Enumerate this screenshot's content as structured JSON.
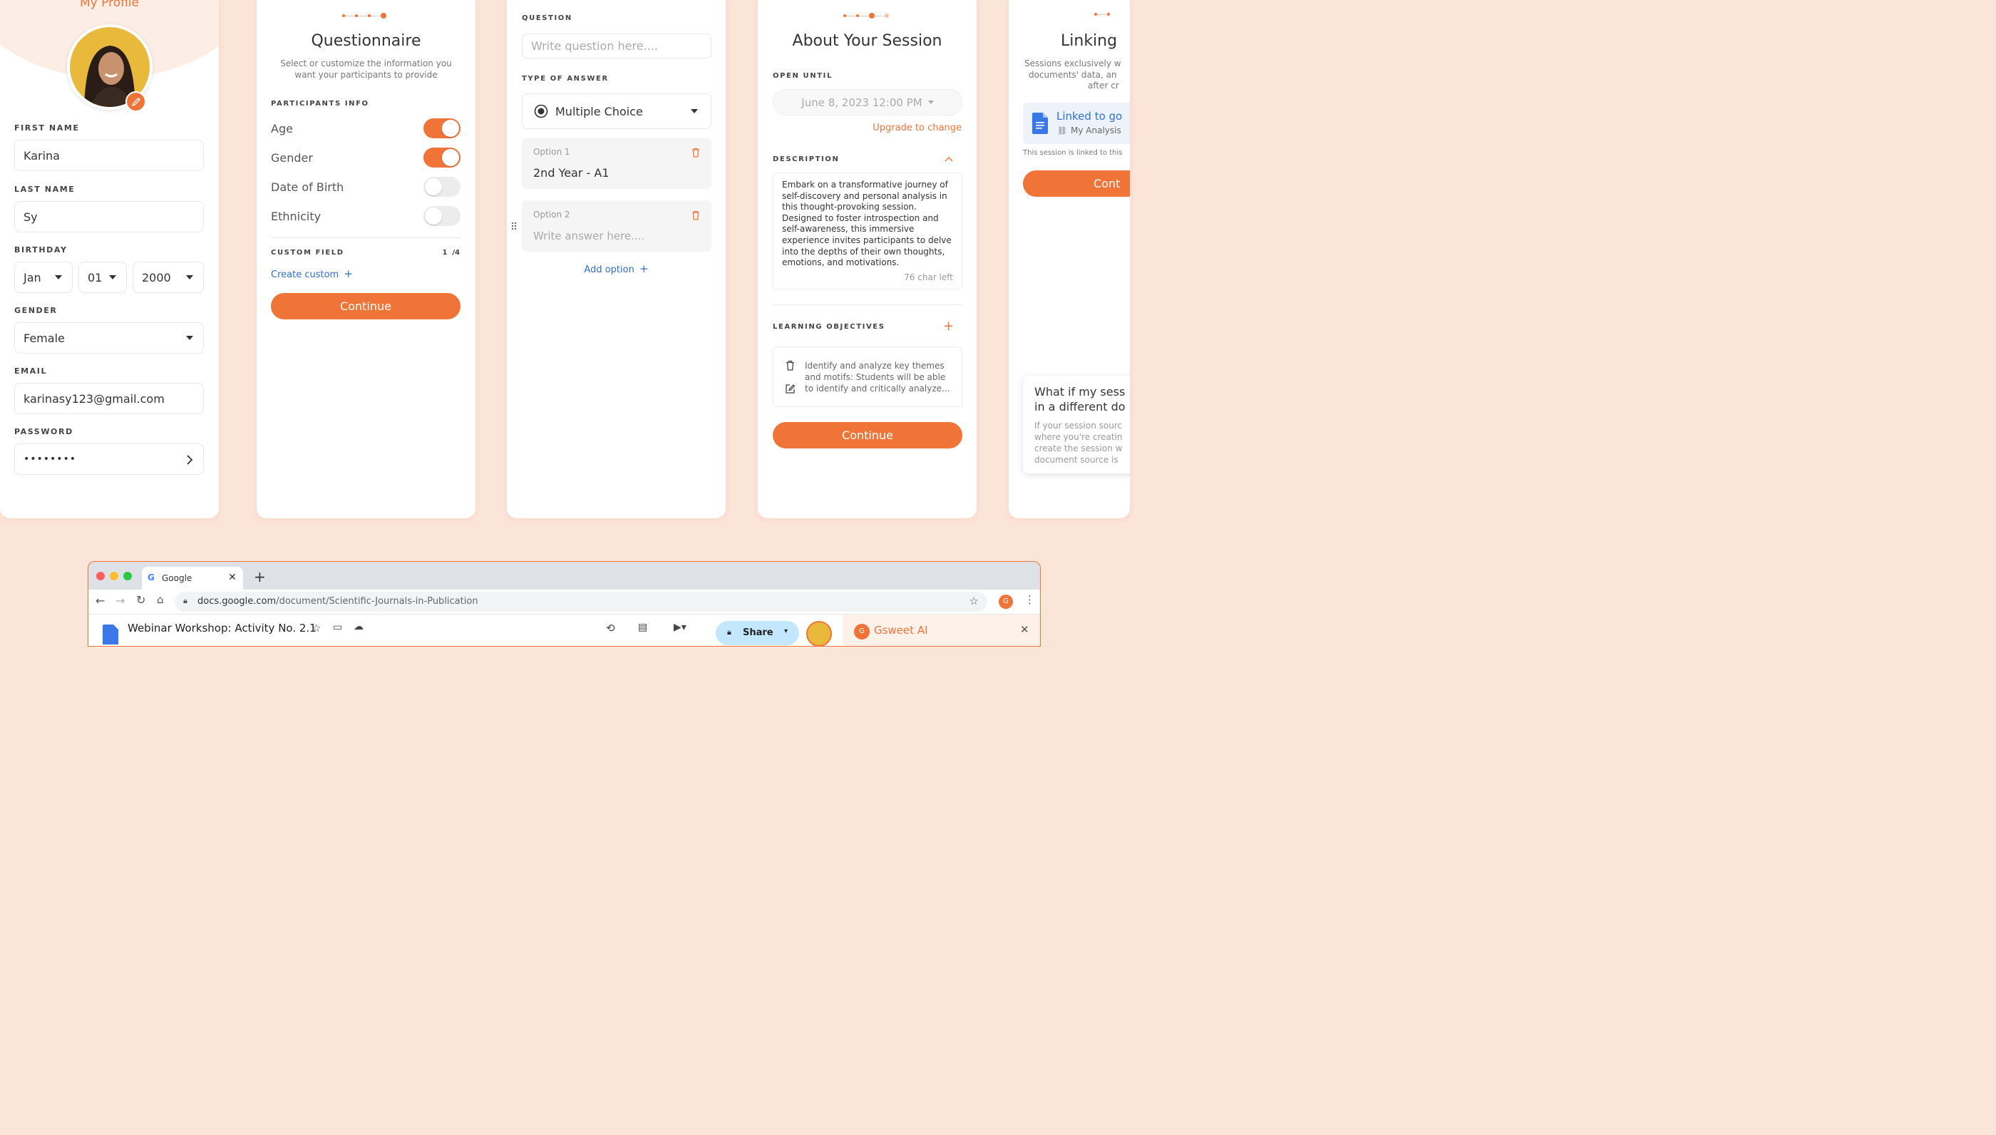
{
  "profile": {
    "title": "My Profile",
    "first_name_label": "FIRST NAME",
    "first_name": "Karina",
    "last_name_label": "LAST NAME",
    "last_name": "Sy",
    "birthday_label": "BIRTHDAY",
    "birth_month": "Jan",
    "birth_day": "01",
    "birth_year": "2000",
    "gender_label": "GENDER",
    "gender": "Female",
    "email_label": "EMAIL",
    "email": "karinasy123@gmail.com",
    "password_label": "PASSWORD",
    "password": "••••••••"
  },
  "questionnaire": {
    "title": "Questionnaire",
    "subtitle_line1": "Select  or customize the information you",
    "subtitle_line2": "want your participants to provide",
    "participants_label": "PARTICIPANTS INFO",
    "fields": [
      {
        "label": "Age",
        "on": true
      },
      {
        "label": "Gender",
        "on": true
      },
      {
        "label": "Date of Birth",
        "on": false
      },
      {
        "label": "Ethnicity",
        "on": false
      }
    ],
    "custom_label": "CUSTOM FIELD",
    "custom_count": "1  /4",
    "create_custom": "Create custom",
    "continue": "Continue"
  },
  "question": {
    "question_label": "QUESTION",
    "question_placeholder": "Write question here....",
    "answer_type_label": "TYPE OF ANSWER",
    "answer_type": "Multiple Choice",
    "options": [
      {
        "label": "Option 1",
        "value": "2nd Year - A1"
      },
      {
        "label": "Option 2",
        "placeholder": "Write answer here...."
      }
    ],
    "add_option": "Add option"
  },
  "session": {
    "title": "About Your Session",
    "open_until_label": "OPEN UNTIL",
    "open_until": "June 8, 2023 12:00 PM",
    "upgrade": "Upgrade to change",
    "description_label": "DESCRIPTION",
    "description_lines": [
      "Embark on a transformative journey of",
      "self-discovery and personal analysis in",
      "this thought-provoking session.",
      "Designed to foster introspection and",
      "self-awareness, this immersive",
      "experience invites participants to delve",
      "into the depths of their own thoughts,",
      "emotions, and motivations."
    ],
    "char_left": "76 char left",
    "objectives_label": "LEARNING OBJECTIVES",
    "objective_lines": [
      "Identify and analyze key themes",
      "and motifs: Students will be able",
      "to identify and critically analyze..."
    ],
    "continue": "Continue"
  },
  "linking": {
    "title": "Linking",
    "sub_lines": [
      "Sessions exclusively w",
      "documents' data, an",
      "after cr"
    ],
    "linked_title": "Linked to go",
    "linked_doc": "My Analysis",
    "linked_note": "This session is linked to this",
    "continue": "Cont",
    "faq_title_1": "What if my sess",
    "faq_title_2": "in a different do",
    "faq_lines": [
      "If your session sourc",
      "where you're creatin",
      "create the session w",
      "document source is"
    ]
  },
  "browser": {
    "tab_title": "Google",
    "url_host": "docs.google.com",
    "url_path": "/document/Scientific-Journals-in-Publication",
    "doc_title": "Webinar Workshop: Activity No. 2.1",
    "share": "Share",
    "sidebar_app": "Gsweet AI"
  },
  "colors": {
    "accent": "#f07438",
    "background": "#fbe4d8",
    "link": "#2f6fd0"
  }
}
